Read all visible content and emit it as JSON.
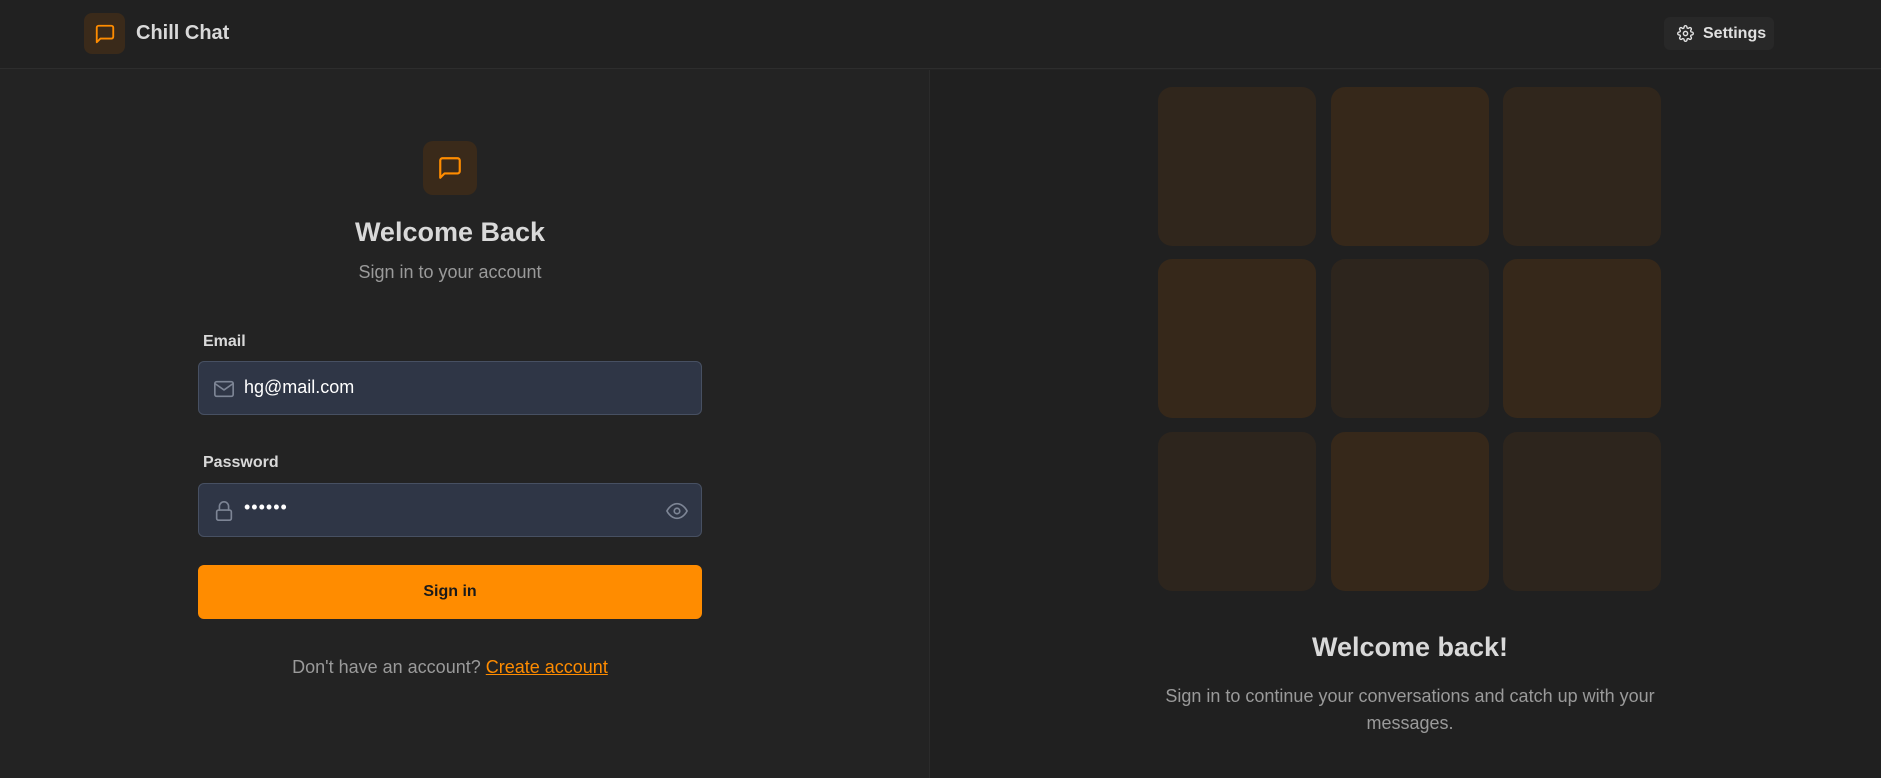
{
  "header": {
    "app_title": "Chill Chat",
    "settings_label": "Settings"
  },
  "login": {
    "title": "Welcome Back",
    "subtitle": "Sign in to your account",
    "email_label": "Email",
    "email_value": "hg@mail.com",
    "password_label": "Password",
    "password_value": "••••••",
    "signin_label": "Sign in",
    "footer_text": "Don't have an account?",
    "footer_link": "Create account"
  },
  "promo": {
    "title": "Welcome back!",
    "subtitle": "Sign in to continue your conversations and catch up with your messages."
  },
  "colors": {
    "accent": "#ff8c00",
    "background": "#232323",
    "input_bg": "#2f3646"
  },
  "icons": [
    "chat-icon",
    "gear-icon",
    "mail-icon",
    "lock-icon",
    "eye-icon"
  ]
}
